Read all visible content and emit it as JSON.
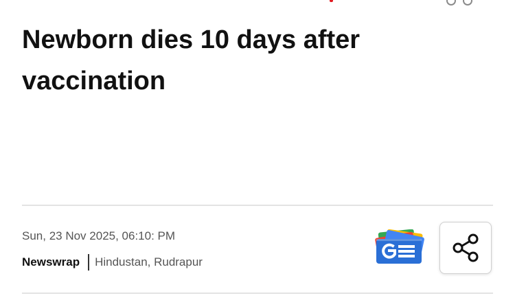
{
  "article": {
    "headline": "Newborn dies 10 days after vaccination",
    "timestamp": "Sun, 23 Nov 2025, 06:10: PM",
    "source": "Newswrap",
    "location": "Hindustan, Rudrapur"
  },
  "actions": {
    "google_news_icon": "google-news-icon",
    "share_icon": "share-icon"
  },
  "colors": {
    "headline": "#111111",
    "meta_text": "#555555",
    "divider": "#e3e3e3",
    "accent_red": "#e11b22",
    "gnews_blue": "#2a6fd6"
  }
}
